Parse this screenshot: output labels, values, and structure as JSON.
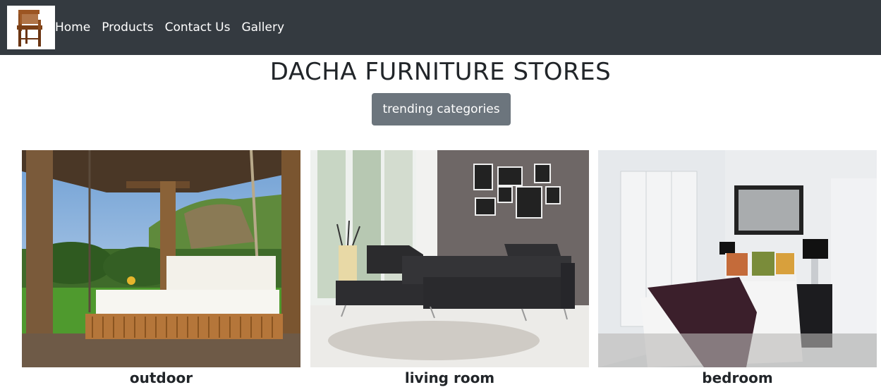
{
  "nav": {
    "logo_icon": "chair-icon",
    "links": [
      {
        "label": "Home"
      },
      {
        "label": "Products"
      },
      {
        "label": "Contact Us"
      },
      {
        "label": "Gallery"
      }
    ]
  },
  "header": {
    "title": "DACHA FURNITURE STORES",
    "button_label": "trending categories"
  },
  "categories": [
    {
      "label": "outdoor"
    },
    {
      "label": "living room"
    },
    {
      "label": "bedroom"
    }
  ],
  "colors": {
    "navbar": "#343a40",
    "button": "#6c757d",
    "text": "#212529"
  }
}
